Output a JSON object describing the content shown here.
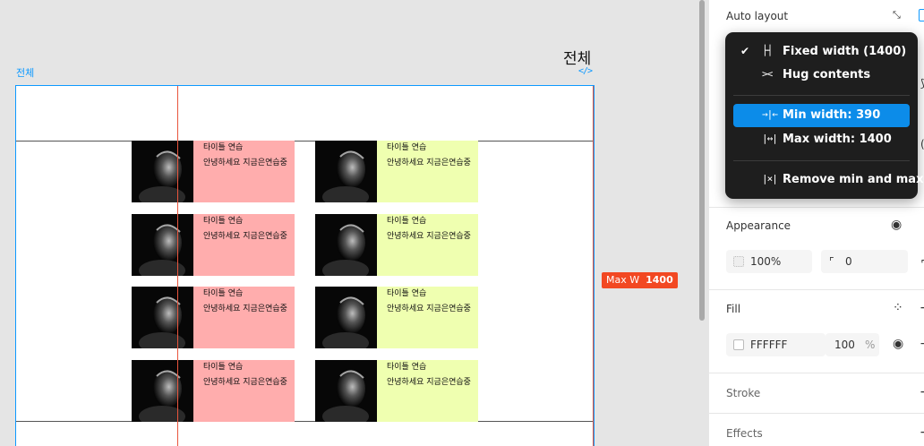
{
  "canvas": {
    "frame_name": "전체",
    "frame_title": "전체",
    "code_icon": "code-icon",
    "maxw_badge": {
      "label": "Max W",
      "value": "1400"
    },
    "cards": [
      {
        "title": "타이틀 연습",
        "desc": "안녕하세요 지금은연습중",
        "color": "#ffadad"
      },
      {
        "title": "타이틀 연습",
        "desc": "안녕하세요 지금은연습중",
        "color": "#efffb0"
      },
      {
        "title": "타이틀 연습",
        "desc": "안녕하세요 지금은연습중",
        "color": "#ffadad"
      },
      {
        "title": "타이틀 연습",
        "desc": "안녕하세요 지금은연습중",
        "color": "#efffb0"
      },
      {
        "title": "타이틀 연습",
        "desc": "안녕하세요 지금은연습중",
        "color": "#ffadad"
      },
      {
        "title": "타이틀 연습",
        "desc": "안녕하세요 지금은연습중",
        "color": "#efffb0"
      },
      {
        "title": "타이틀 연습",
        "desc": "안녕하세요 지금은연습중",
        "color": "#ffadad"
      },
      {
        "title": "타이틀 연습",
        "desc": "안녕하세요 지금은연습중",
        "color": "#efffb0"
      }
    ]
  },
  "panel": {
    "auto_layout": {
      "title": "Auto layout"
    },
    "dropdown": {
      "items": [
        {
          "label": "Fixed width (1400)",
          "icon": "fixed-width-icon",
          "checked": true
        },
        {
          "label": "Hug contents",
          "icon": "hug-contents-icon",
          "checked": false
        },
        {
          "label": "Min width: 390",
          "icon": "min-width-icon",
          "active": true
        },
        {
          "label": "Max width: 1400",
          "icon": "max-width-icon"
        },
        {
          "label": "Remove min and max",
          "icon": "remove-min-max-icon"
        }
      ]
    },
    "appearance": {
      "title": "Appearance",
      "opacity": "100%",
      "radius": "0"
    },
    "fill": {
      "title": "Fill",
      "hex": "FFFFFF",
      "opacity": "100",
      "opacity_unit": "%",
      "swatch": "#ffffff"
    },
    "stroke": {
      "title": "Stroke"
    },
    "effects": {
      "title": "Effects"
    }
  },
  "colors": {
    "accent": "#0d99ff",
    "guide": "#e8553d",
    "badge": "#f24822",
    "menu_active": "#0c8ce9"
  }
}
